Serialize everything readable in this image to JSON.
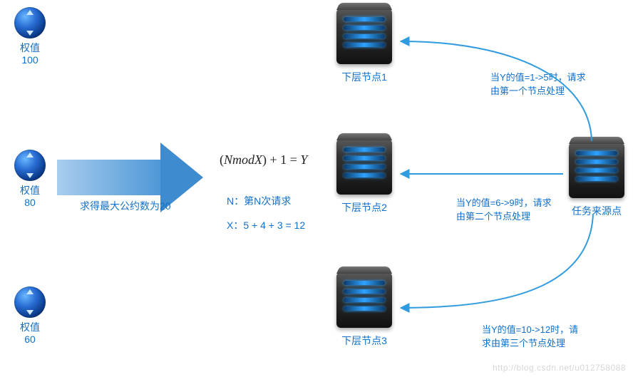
{
  "weights": [
    {
      "label": "权值",
      "value": "100"
    },
    {
      "label": "权值",
      "value": "80"
    },
    {
      "label": "权值",
      "value": "60"
    }
  ],
  "gcd_text": "求得最大公约数为20",
  "formula": {
    "expr": "(NmodX) + 1 = Y",
    "n_line": "N：第N次请求",
    "x_line": "X：5 + 4 + 3 = 12"
  },
  "servers": {
    "node1": "下层节点1",
    "node2": "下层节点2",
    "node3": "下层节点3",
    "source": "任务来源点"
  },
  "routes": {
    "r1a": "当Y的值=1->5时，请求",
    "r1b": "由第一个节点处理",
    "r2a": "当Y的值=6->9时，请求",
    "r2b": "由第二个节点处理",
    "r3a": "当Y的值=10->12时，请",
    "r3b": "求由第三个节点处理"
  },
  "watermark": "http://blog.csdn.net/u012758088"
}
